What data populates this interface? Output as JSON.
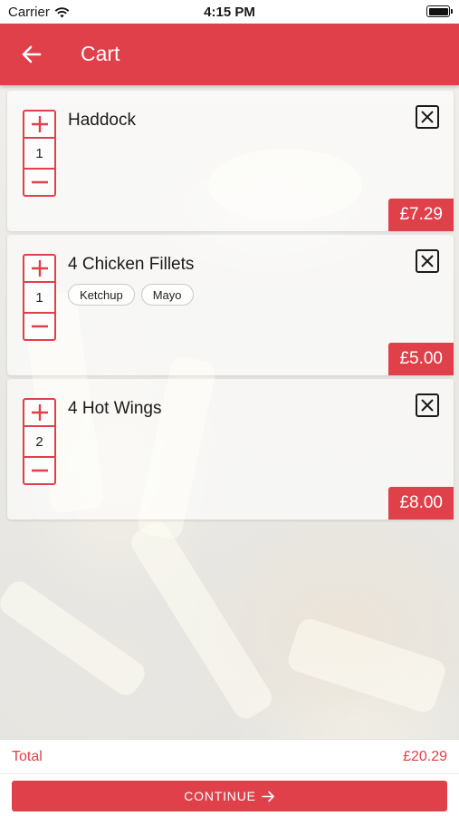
{
  "status_bar": {
    "carrier": "Carrier",
    "time": "4:15 PM"
  },
  "header": {
    "title": "Cart",
    "back_icon": "arrow-left-icon"
  },
  "colors": {
    "brand": "#e0404a",
    "text": "#1a1a1a"
  },
  "cart": {
    "items": [
      {
        "name": "Haddock",
        "quantity": "1",
        "price": "£7.29",
        "options": []
      },
      {
        "name": "4 Chicken Fillets",
        "quantity": "1",
        "price": "£5.00",
        "options": [
          "Ketchup",
          "Mayo"
        ]
      },
      {
        "name": "4 Hot Wings",
        "quantity": "2",
        "price": "£8.00",
        "options": []
      }
    ]
  },
  "footer": {
    "total_label": "Total",
    "total_value": "£20.29",
    "continue_label": "CONTINUE",
    "continue_icon": "arrow-right-icon"
  }
}
